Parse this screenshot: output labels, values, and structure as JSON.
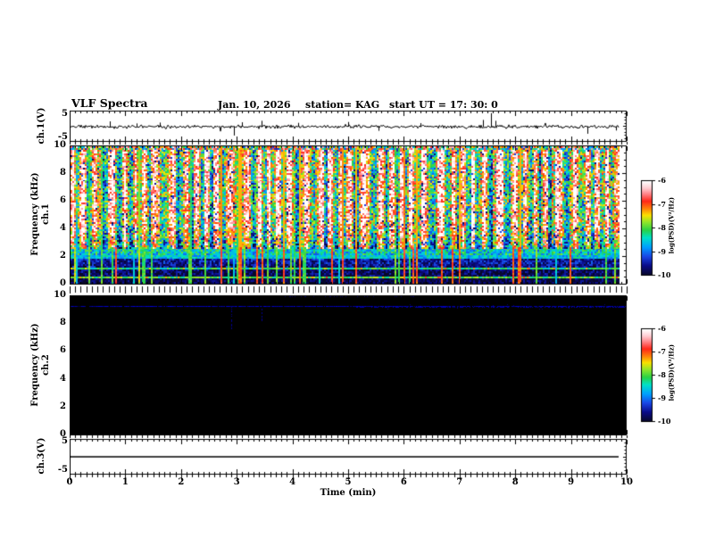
{
  "figure": {
    "header": {
      "title": "VLF Spectra",
      "date": "Jan. 10, 2026",
      "station": "station= KAG",
      "start_ut": "start UT =  17: 30: 0"
    }
  },
  "time_axis": {
    "label": "Time (min)",
    "ticks": [
      "0",
      "1",
      "2",
      "3",
      "4",
      "5",
      "6",
      "7",
      "8",
      "9",
      "10"
    ],
    "min": 0,
    "max": 10,
    "minor_step": 0.1,
    "data_end_min": 9.85
  },
  "panels": {
    "ch1wave": {
      "ylabel": "ch.1(V)",
      "ytick_top": "5",
      "ytick_bottom": "-5",
      "ylim": [
        -5,
        5
      ]
    },
    "ch1spec": {
      "ylabel_channel": "ch.1",
      "ylabel_axis": "Frequency (kHz)",
      "yticks": [
        "10",
        "8",
        "6",
        "4",
        "2",
        "0"
      ],
      "ylim": [
        0,
        10
      ]
    },
    "ch2spec": {
      "ylabel_channel": "ch.2",
      "ylabel_axis": "Frequency (kHz)",
      "yticks": [
        "10",
        "8",
        "6",
        "4",
        "2",
        "0"
      ],
      "ylim": [
        0,
        10
      ]
    },
    "ch3wave": {
      "ylabel": "ch.3(V)",
      "ytick_top": "5",
      "ytick_bottom": "-5",
      "ylim": [
        -5,
        5
      ]
    }
  },
  "colorbar": {
    "label": "log(PSD)(V²/Hz)",
    "ticks": [
      "-6",
      "-7",
      "-8",
      "-9",
      "-10"
    ],
    "max": -6,
    "min": -10
  },
  "palette": [
    [
      0.0,
      [
        8,
        8,
        40
      ]
    ],
    [
      0.1,
      [
        10,
        10,
        135
      ]
    ],
    [
      0.2,
      [
        25,
        70,
        230
      ]
    ],
    [
      0.3,
      [
        0,
        160,
        255
      ]
    ],
    [
      0.4,
      [
        0,
        225,
        200
      ]
    ],
    [
      0.48,
      [
        40,
        210,
        70
      ]
    ],
    [
      0.57,
      [
        150,
        230,
        40
      ]
    ],
    [
      0.64,
      [
        250,
        225,
        0
      ]
    ],
    [
      0.71,
      [
        255,
        130,
        10
      ]
    ],
    [
      0.79,
      [
        255,
        40,
        25
      ]
    ],
    [
      0.87,
      [
        255,
        135,
        140
      ]
    ],
    [
      0.93,
      [
        255,
        205,
        210
      ]
    ],
    [
      1.0,
      [
        255,
        255,
        255
      ]
    ]
  ],
  "render_seed": 77,
  "chart_data": [
    {
      "type": "line",
      "panel": "ch.1(V) waveform",
      "xlim": [
        0,
        10
      ],
      "ylim": [
        -5,
        5
      ],
      "baseline_v": 0,
      "noise_v_rms": 0.35,
      "spikes": [
        {
          "t": 0.72,
          "v": 1.8
        },
        {
          "t": 1.2,
          "v": 1.1
        },
        {
          "t": 1.62,
          "v": 1.4
        },
        {
          "t": 2.95,
          "v": -3.0
        },
        {
          "t": 3.1,
          "v": 1.5
        },
        {
          "t": 3.45,
          "v": 2.0
        },
        {
          "t": 4.1,
          "v": 1.3
        },
        {
          "t": 5.0,
          "v": 1.6
        },
        {
          "t": 5.55,
          "v": -1.4
        },
        {
          "t": 6.3,
          "v": 1.2
        },
        {
          "t": 7.42,
          "v": 2.3
        },
        {
          "t": 7.56,
          "v": 4.6
        },
        {
          "t": 7.64,
          "v": 2.0
        },
        {
          "t": 9.3,
          "v": -2.4
        },
        {
          "t": 9.8,
          "v": -1.3
        }
      ]
    },
    {
      "type": "heatmap",
      "panel": "ch.1 spectrogram",
      "xlim": [
        0,
        10
      ],
      "ylim_khz": [
        0,
        10
      ],
      "value_range_log_psd": [
        -10,
        -6
      ],
      "structure": {
        "top_speckle_khz": [
          9.72,
          10
        ],
        "streak_zone_khz": [
          2.6,
          9.72
        ],
        "transition_zone_khz": [
          2.1,
          2.6
        ],
        "bands": [
          {
            "khz": [
              1.85,
              2.1
            ],
            "level": -8.6
          },
          {
            "khz": [
              1.35,
              1.85
            ],
            "level": -9.5
          },
          {
            "khz": [
              1.12,
              1.35
            ],
            "level": -9.6
          },
          {
            "khz": [
              0.98,
              1.12
            ],
            "level": -8.2
          },
          {
            "khz": [
              0.52,
              0.98
            ],
            "level": -9.8
          },
          {
            "khz": [
              0.4,
              0.52
            ],
            "level": -8.0
          },
          {
            "khz": [
              0.0,
              0.4
            ],
            "level": -9.9
          }
        ],
        "vertical_line_count": 55
      }
    },
    {
      "type": "heatmap",
      "panel": "ch.2 spectrogram",
      "xlim": [
        0,
        10
      ],
      "ylim_khz": [
        0,
        10
      ],
      "value_range_log_psd": [
        -10,
        -6
      ],
      "background_level": -10,
      "lines": [
        {
          "khz": 9.2,
          "level": -9.3,
          "style": "speckled blue, denser toward right"
        }
      ],
      "vertical_dashes": [
        {
          "t": 2.9,
          "khz": [
            7.4,
            9.2
          ]
        },
        {
          "t": 3.45,
          "khz": [
            8.2,
            9.2
          ]
        }
      ]
    },
    {
      "type": "line",
      "panel": "ch.3(V) waveform",
      "xlim": [
        0,
        10
      ],
      "ylim": [
        -5,
        5
      ],
      "constant_v": 0
    }
  ]
}
